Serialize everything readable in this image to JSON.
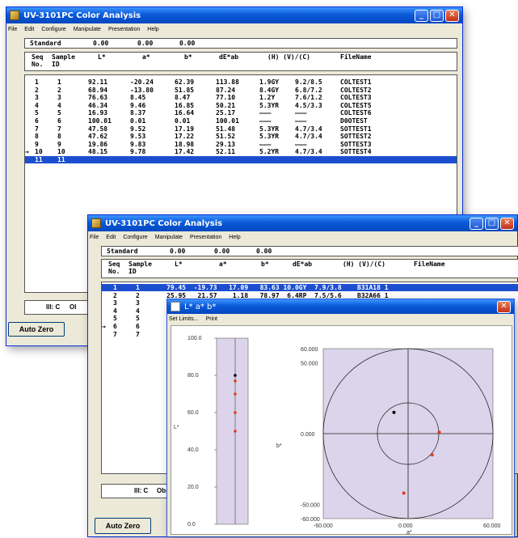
{
  "win1": {
    "title": "UV-3101PC Color Analysis",
    "menu": [
      "File",
      "Edit",
      "Configure",
      "Manipulate",
      "Presentation",
      "Help"
    ],
    "standard": {
      "label": "Standard",
      "v1": "0.00",
      "v2": "0.00",
      "v3": "0.00"
    },
    "headers": {
      "seq": "Seq\nNo.",
      "sample": "Sample\nID",
      "l": "L*",
      "a": "a*",
      "b": "b*",
      "de": "dE*ab",
      "hvc": "(H) (V)/(C)",
      "file": "FileName"
    },
    "rows": [
      {
        "seq": "1",
        "id": "1",
        "l": "92.11",
        "a": "-20.24",
        "b": "62.39",
        "de": "113.88",
        "h": "1.9GY",
        "vc": "9.2/8.5",
        "file": "COLTEST1"
      },
      {
        "seq": "2",
        "id": "2",
        "l": "68.94",
        "a": "-13.80",
        "b": "51.85",
        "de": "87.24",
        "h": "8.4GY",
        "vc": "6.8/7.2",
        "file": "COLTEST2"
      },
      {
        "seq": "3",
        "id": "3",
        "l": "76.63",
        "a": "8.45",
        "b": "8.47",
        "de": "77.10",
        "h": "1.2Y",
        "vc": "7.6/1.2",
        "file": "COLTEST3"
      },
      {
        "seq": "4",
        "id": "4",
        "l": "46.34",
        "a": "9.46",
        "b": "16.85",
        "de": "50.21",
        "h": "5.3YR",
        "vc": "4.5/3.3",
        "file": "COLTEST5"
      },
      {
        "seq": "5",
        "id": "5",
        "l": "16.93",
        "a": "8.37",
        "b": "16.64",
        "de": "25.17",
        "h": "———",
        "vc": "———",
        "file": "COLTEST6"
      },
      {
        "seq": "6",
        "id": "6",
        "l": "100.01",
        "a": "0.01",
        "b": "0.01",
        "de": "100.01",
        "h": "———",
        "vc": "———",
        "file": "D0OTEST"
      },
      {
        "seq": "7",
        "id": "7",
        "l": "47.58",
        "a": "9.52",
        "b": "17.19",
        "de": "51.48",
        "h": "5.3YR",
        "vc": "4.7/3.4",
        "file": "SOTTEST1"
      },
      {
        "seq": "8",
        "id": "8",
        "l": "47.62",
        "a": "9.53",
        "b": "17.22",
        "de": "51.52",
        "h": "5.3YR",
        "vc": "4.7/3.4",
        "file": "SOTTEST2"
      },
      {
        "seq": "9",
        "id": "9",
        "l": "19.86",
        "a": "9.83",
        "b": "18.98",
        "de": "29.13",
        "h": "———",
        "vc": "———",
        "file": "SOTTEST3"
      },
      {
        "seq": "10",
        "id": "10",
        "l": "48.15",
        "a": "9.78",
        "b": "17.42",
        "de": "52.11",
        "h": "5.2YR",
        "vc": "4.7/3.4",
        "file": "SOTTEST4"
      },
      {
        "seq": "11",
        "id": "11",
        "l": "",
        "a": "",
        "b": "",
        "de": "",
        "h": "",
        "vc": "",
        "file": ""
      }
    ],
    "pointer_row": "→",
    "status": "Ill: C",
    "status_tail": "Ol",
    "auto_zero": "Auto Zero"
  },
  "win2": {
    "title": "UV-3101PC Color Analysis",
    "menu": [
      "File",
      "Edit",
      "Configure",
      "Manipulate",
      "Presentation",
      "Help"
    ],
    "standard": {
      "label": "Standard",
      "v1": "0.00",
      "v2": "0.00",
      "v3": "0.00"
    },
    "headers": {
      "seq": "Seq\nNo.",
      "sample": "Sample\nID",
      "l": "L*",
      "a": "a*",
      "b": "b*",
      "de": "dE*ab",
      "hvc": "(H) (V)/(C)",
      "file": "FileName"
    },
    "rows": [
      {
        "seq": "1",
        "id": "1",
        "rest": "79.45  -19.73   17.09   83.63 10.0GY  7.9/3.8    B31A18 1"
      },
      {
        "seq": "2",
        "id": "2",
        "rest": "25.95   21.57    1.18   78.97  6.4RP  7.5/5.6    B32A66 1"
      },
      {
        "seq": "3",
        "id": "3",
        "rest": ""
      },
      {
        "seq": "4",
        "id": "4",
        "rest": ""
      },
      {
        "seq": "5",
        "id": "5",
        "rest": ""
      },
      {
        "seq": "6",
        "id": "6",
        "rest": ""
      },
      {
        "seq": "7",
        "id": "7",
        "rest": ""
      }
    ],
    "pointer_row": "→",
    "status": "Ill: C",
    "status_tail": "Obs",
    "auto_zero": "Auto Zero"
  },
  "plot": {
    "title": "L* a* b*",
    "menu": [
      "Set Limits...",
      "Print"
    ],
    "l_axis_label": "L*",
    "b_axis_label": "b*",
    "a_axis_label": "a*"
  },
  "chart_data": [
    {
      "type": "scatter",
      "title": "",
      "ylabel": "L*",
      "ylim": [
        0,
        100
      ],
      "yticks": [
        "0.0",
        "20.0",
        "40.0",
        "60.0",
        "80.0",
        "100.0"
      ],
      "points": [
        {
          "y": 80,
          "color": "#000000"
        },
        {
          "y": 77,
          "color": "#e03c1c"
        },
        {
          "y": 70,
          "color": "#e03c1c"
        },
        {
          "y": 60,
          "color": "#e03c1c"
        },
        {
          "y": 50,
          "color": "#e03c1c"
        }
      ]
    },
    {
      "type": "scatter",
      "title": "",
      "xlabel": "a*",
      "ylabel": "b*",
      "xlim": [
        -60,
        60
      ],
      "ylim": [
        -60,
        60
      ],
      "xticks": [
        "-60.000",
        "0.000",
        "60.000"
      ],
      "yticks": [
        "60.000",
        "50.000",
        "0.000",
        "-50.000",
        "-60.000"
      ],
      "points": [
        {
          "x": -10,
          "y": 15,
          "color": "#000000"
        },
        {
          "x": 22,
          "y": 1,
          "color": "#e03c1c"
        },
        {
          "x": 17,
          "y": -15,
          "color": "#e03c1c"
        },
        {
          "x": -3,
          "y": -42,
          "color": "#e03c1c"
        }
      ]
    }
  ]
}
